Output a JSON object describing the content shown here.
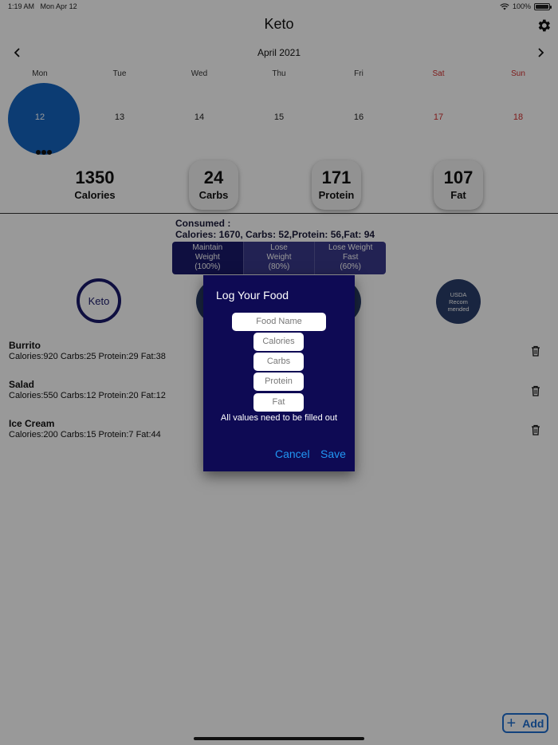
{
  "status": {
    "time": "1:19 AM",
    "date": "Mon Apr 12",
    "battery": "100%",
    "battery_level": 1.0
  },
  "header": {
    "title": "Keto",
    "settings_icon": "gear-icon"
  },
  "calendar": {
    "month": "April 2021",
    "prev_icon": "chevron-left-icon",
    "next_icon": "chevron-right-icon",
    "days": [
      {
        "name": "Mon",
        "num": "12",
        "selected": true
      },
      {
        "name": "Tue",
        "num": "13"
      },
      {
        "name": "Wed",
        "num": "14"
      },
      {
        "name": "Thu",
        "num": "15"
      },
      {
        "name": "Fri",
        "num": "16"
      },
      {
        "name": "Sat",
        "num": "17",
        "weekend": true
      },
      {
        "name": "Sun",
        "num": "18",
        "weekend": true
      }
    ],
    "weekend_color": "#d32f2f",
    "selected_color": "#1565c0"
  },
  "targets": {
    "calories": {
      "value": "1350",
      "label": "Calories"
    },
    "carbs": {
      "value": "24",
      "label": "Carbs"
    },
    "protein": {
      "value": "171",
      "label": "Protein"
    },
    "fat": {
      "value": "107",
      "label": "Fat"
    }
  },
  "consumed": {
    "heading": "Consumed :",
    "summary": "Calories: 1670, Carbs: 52,Protein: 56,Fat: 94"
  },
  "goals": [
    {
      "line1": "Maintain",
      "line2": "Weight",
      "line3": "(100%)",
      "active": true
    },
    {
      "line1": "Lose",
      "line2": "Weight",
      "line3": "(80%)"
    },
    {
      "line1": "Lose Weight",
      "line2": "Fast",
      "line3": "(60%)"
    }
  ],
  "diets": {
    "keto": "Keto",
    "usda_line1": "USDA",
    "usda_line2": "Recom",
    "usda_line3": "mended"
  },
  "foods": [
    {
      "name": "Burrito",
      "detail": "Calories:920 Carbs:25 Protein:29 Fat:38"
    },
    {
      "name": "Salad",
      "detail": "Calories:550 Carbs:12 Protein:20 Fat:12"
    },
    {
      "name": "Ice Cream",
      "detail": "Calories:200 Carbs:15 Protein:7 Fat:44"
    }
  ],
  "dialog": {
    "title": "Log Your Food",
    "food_name_placeholder": "Food Name",
    "calories_placeholder": "Calories",
    "carbs_placeholder": "Carbs",
    "protein_placeholder": "Protein",
    "fat_placeholder": "Fat",
    "message": "All values need to be filled out",
    "cancel": "Cancel",
    "save": "Save"
  },
  "add_button": {
    "label": "Add",
    "icon": "plus-icon"
  },
  "colors": {
    "accent": "#2196f3",
    "dialog_bg": "#0e0a54",
    "navy": "#1a1a6b"
  }
}
